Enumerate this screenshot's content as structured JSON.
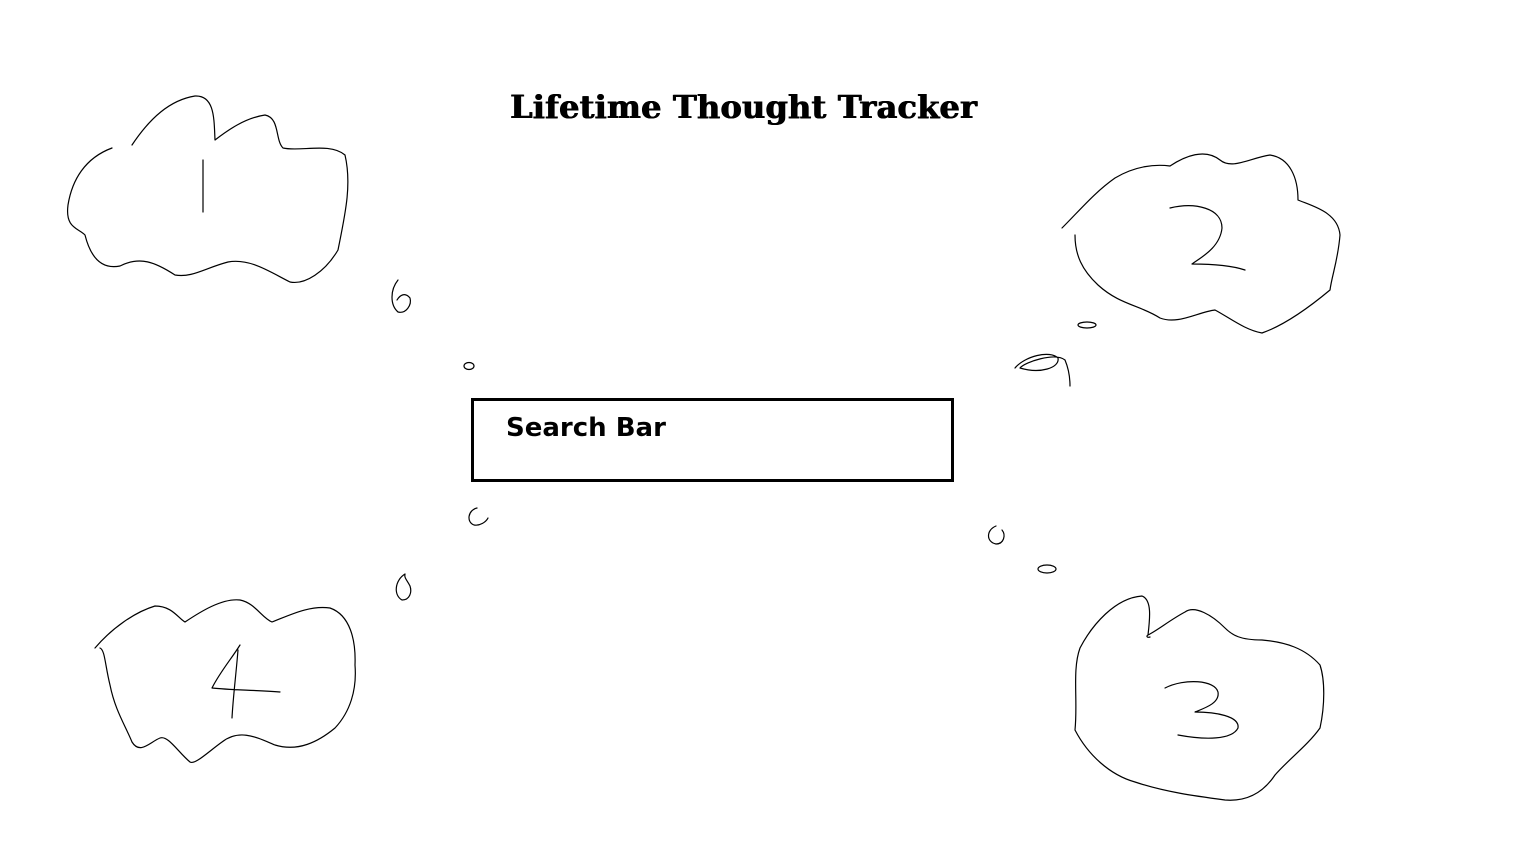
{
  "title": "Lifetime Thought Tracker",
  "search": {
    "label": "Search Bar"
  },
  "thought_clouds": [
    {
      "label": "1"
    },
    {
      "label": "2"
    },
    {
      "label": "3"
    },
    {
      "label": "4"
    }
  ]
}
